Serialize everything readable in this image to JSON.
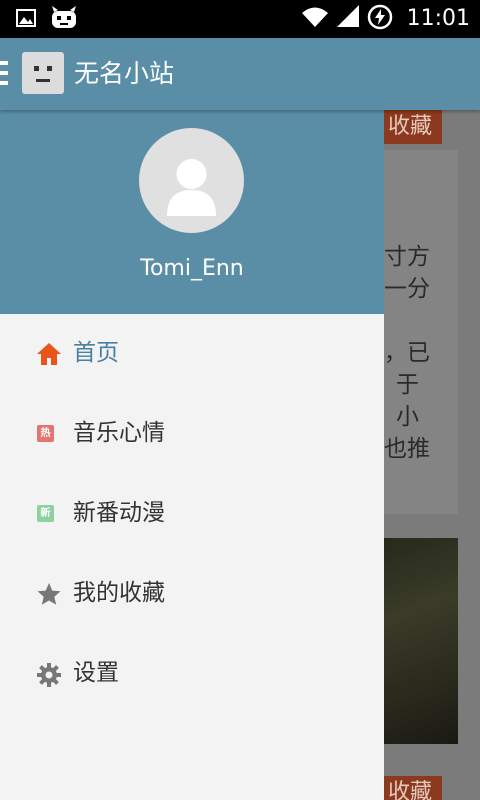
{
  "status_bar": {
    "time": "11:01"
  },
  "app_bar": {
    "title": "无名小站"
  },
  "drawer": {
    "username": "Tomi_Enn",
    "items": [
      {
        "label": "首页",
        "icon": "home-icon",
        "active": true
      },
      {
        "label": "音乐心情",
        "icon": "hot-badge-icon",
        "badge": "热"
      },
      {
        "label": "新番动漫",
        "icon": "new-badge-icon",
        "badge": "新"
      },
      {
        "label": "我的收藏",
        "icon": "star-icon"
      },
      {
        "label": "设置",
        "icon": "gear-icon"
      }
    ]
  },
  "background_content": {
    "fav_label": "收藏",
    "snippet_lines": [
      "寸方",
      "一分",
      "",
      "，已",
      "于",
      "小",
      "也推"
    ]
  },
  "colors": {
    "primary": "#5a8ea6",
    "accent_home": "#e8541a",
    "badge_hot": "#e57373",
    "badge_new": "#8fd19e",
    "icon_gray": "#777777"
  }
}
